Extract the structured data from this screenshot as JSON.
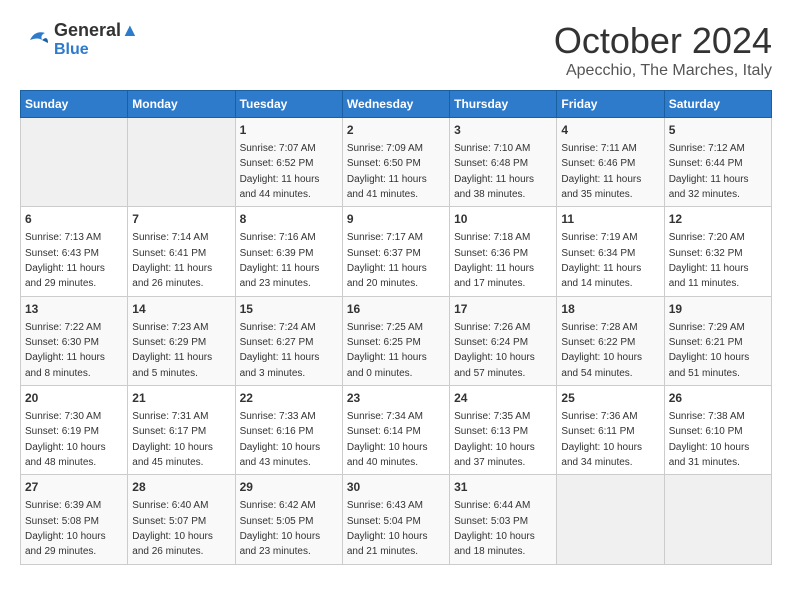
{
  "header": {
    "logo_line1": "General",
    "logo_line2": "Blue",
    "month": "October 2024",
    "location": "Apecchio, The Marches, Italy"
  },
  "days_of_week": [
    "Sunday",
    "Monday",
    "Tuesday",
    "Wednesday",
    "Thursday",
    "Friday",
    "Saturday"
  ],
  "weeks": [
    [
      {
        "day": "",
        "empty": true
      },
      {
        "day": "",
        "empty": true
      },
      {
        "day": "1",
        "sunrise": "7:07 AM",
        "sunset": "6:52 PM",
        "daylight": "11 hours and 44 minutes."
      },
      {
        "day": "2",
        "sunrise": "7:09 AM",
        "sunset": "6:50 PM",
        "daylight": "11 hours and 41 minutes."
      },
      {
        "day": "3",
        "sunrise": "7:10 AM",
        "sunset": "6:48 PM",
        "daylight": "11 hours and 38 minutes."
      },
      {
        "day": "4",
        "sunrise": "7:11 AM",
        "sunset": "6:46 PM",
        "daylight": "11 hours and 35 minutes."
      },
      {
        "day": "5",
        "sunrise": "7:12 AM",
        "sunset": "6:44 PM",
        "daylight": "11 hours and 32 minutes."
      }
    ],
    [
      {
        "day": "6",
        "sunrise": "7:13 AM",
        "sunset": "6:43 PM",
        "daylight": "11 hours and 29 minutes."
      },
      {
        "day": "7",
        "sunrise": "7:14 AM",
        "sunset": "6:41 PM",
        "daylight": "11 hours and 26 minutes."
      },
      {
        "day": "8",
        "sunrise": "7:16 AM",
        "sunset": "6:39 PM",
        "daylight": "11 hours and 23 minutes."
      },
      {
        "day": "9",
        "sunrise": "7:17 AM",
        "sunset": "6:37 PM",
        "daylight": "11 hours and 20 minutes."
      },
      {
        "day": "10",
        "sunrise": "7:18 AM",
        "sunset": "6:36 PM",
        "daylight": "11 hours and 17 minutes."
      },
      {
        "day": "11",
        "sunrise": "7:19 AM",
        "sunset": "6:34 PM",
        "daylight": "11 hours and 14 minutes."
      },
      {
        "day": "12",
        "sunrise": "7:20 AM",
        "sunset": "6:32 PM",
        "daylight": "11 hours and 11 minutes."
      }
    ],
    [
      {
        "day": "13",
        "sunrise": "7:22 AM",
        "sunset": "6:30 PM",
        "daylight": "11 hours and 8 minutes."
      },
      {
        "day": "14",
        "sunrise": "7:23 AM",
        "sunset": "6:29 PM",
        "daylight": "11 hours and 5 minutes."
      },
      {
        "day": "15",
        "sunrise": "7:24 AM",
        "sunset": "6:27 PM",
        "daylight": "11 hours and 3 minutes."
      },
      {
        "day": "16",
        "sunrise": "7:25 AM",
        "sunset": "6:25 PM",
        "daylight": "11 hours and 0 minutes."
      },
      {
        "day": "17",
        "sunrise": "7:26 AM",
        "sunset": "6:24 PM",
        "daylight": "10 hours and 57 minutes."
      },
      {
        "day": "18",
        "sunrise": "7:28 AM",
        "sunset": "6:22 PM",
        "daylight": "10 hours and 54 minutes."
      },
      {
        "day": "19",
        "sunrise": "7:29 AM",
        "sunset": "6:21 PM",
        "daylight": "10 hours and 51 minutes."
      }
    ],
    [
      {
        "day": "20",
        "sunrise": "7:30 AM",
        "sunset": "6:19 PM",
        "daylight": "10 hours and 48 minutes."
      },
      {
        "day": "21",
        "sunrise": "7:31 AM",
        "sunset": "6:17 PM",
        "daylight": "10 hours and 45 minutes."
      },
      {
        "day": "22",
        "sunrise": "7:33 AM",
        "sunset": "6:16 PM",
        "daylight": "10 hours and 43 minutes."
      },
      {
        "day": "23",
        "sunrise": "7:34 AM",
        "sunset": "6:14 PM",
        "daylight": "10 hours and 40 minutes."
      },
      {
        "day": "24",
        "sunrise": "7:35 AM",
        "sunset": "6:13 PM",
        "daylight": "10 hours and 37 minutes."
      },
      {
        "day": "25",
        "sunrise": "7:36 AM",
        "sunset": "6:11 PM",
        "daylight": "10 hours and 34 minutes."
      },
      {
        "day": "26",
        "sunrise": "7:38 AM",
        "sunset": "6:10 PM",
        "daylight": "10 hours and 31 minutes."
      }
    ],
    [
      {
        "day": "27",
        "sunrise": "6:39 AM",
        "sunset": "5:08 PM",
        "daylight": "10 hours and 29 minutes."
      },
      {
        "day": "28",
        "sunrise": "6:40 AM",
        "sunset": "5:07 PM",
        "daylight": "10 hours and 26 minutes."
      },
      {
        "day": "29",
        "sunrise": "6:42 AM",
        "sunset": "5:05 PM",
        "daylight": "10 hours and 23 minutes."
      },
      {
        "day": "30",
        "sunrise": "6:43 AM",
        "sunset": "5:04 PM",
        "daylight": "10 hours and 21 minutes."
      },
      {
        "day": "31",
        "sunrise": "6:44 AM",
        "sunset": "5:03 PM",
        "daylight": "10 hours and 18 minutes."
      },
      {
        "day": "",
        "empty": true
      },
      {
        "day": "",
        "empty": true
      }
    ]
  ]
}
